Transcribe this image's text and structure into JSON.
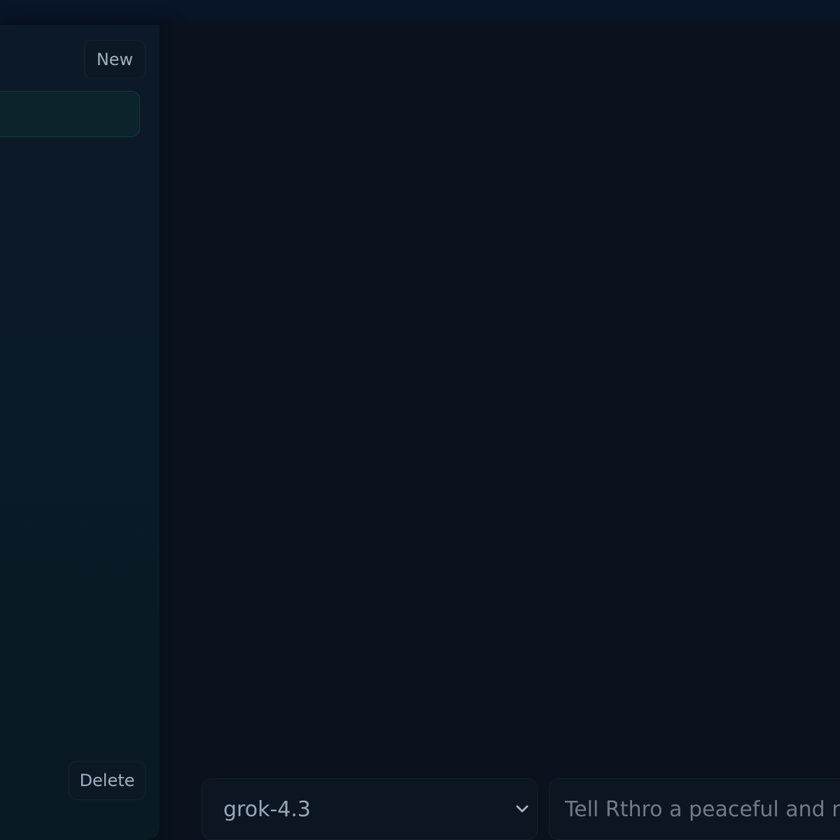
{
  "sidebar": {
    "new_label": "New",
    "delete_label": "Delete"
  },
  "composer": {
    "model_selected": "grok-4.3",
    "prompt_placeholder": "Tell Rthro a peaceful and nic"
  },
  "colors": {
    "background": "#0b121e",
    "sidebar": "#0b1a26",
    "active_item_border": "#123a3d",
    "text_primary": "#9fb0bf",
    "text_placeholder": "#6f7c88"
  },
  "icons": {
    "model_dropdown": "chevron-down-icon"
  }
}
